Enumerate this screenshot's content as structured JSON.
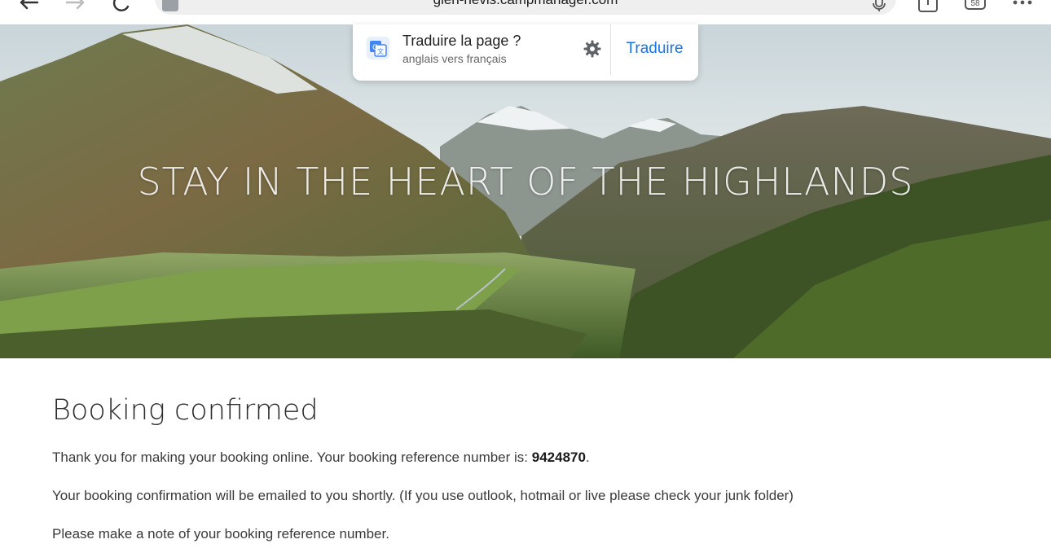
{
  "browser": {
    "url": "glen-nevis.campmanager.com",
    "tab_count": "58"
  },
  "translate_bar": {
    "title": "Traduire la page ?",
    "subtitle": "anglais vers français",
    "action_label": "Traduire",
    "accent_color": "#1a73e8"
  },
  "hero": {
    "headline": "STAY IN THE HEART OF THE HIGHLANDS"
  },
  "confirmation": {
    "heading": "Booking confirmed",
    "line1_prefix": "Thank you for making your booking online. Your booking reference number is: ",
    "reference_number": "9424870",
    "line1_suffix": ".",
    "line2": "Your booking confirmation will be emailed to you shortly. (If you use outlook, hotmail or live please check your junk folder)",
    "line3": "Please make a note of your booking reference number."
  }
}
